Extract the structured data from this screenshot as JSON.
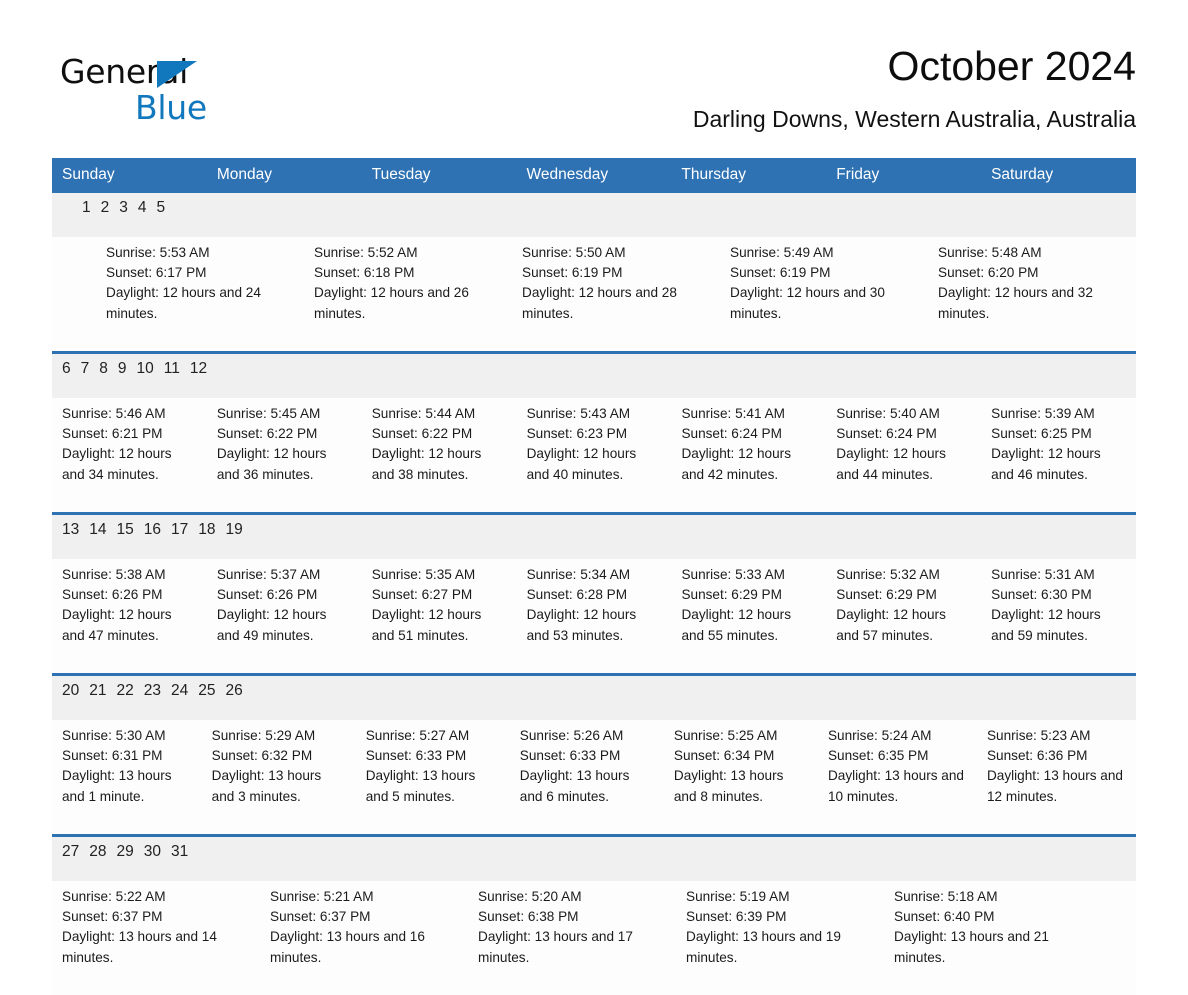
{
  "brand": {
    "name_part1": "General",
    "name_part2": "Blue",
    "triangle_icon": "blue-triangle-logo-mark",
    "accent_color": "#1278be"
  },
  "header": {
    "title": "October 2024",
    "location": "Darling Downs, Western Australia, Australia"
  },
  "colors": {
    "header_blue": "#2e72b3",
    "daynum_band": "#f0f0f0",
    "text": "#1a1a1a"
  },
  "weekday_headers": [
    "Sunday",
    "Monday",
    "Tuesday",
    "Wednesday",
    "Thursday",
    "Friday",
    "Saturday"
  ],
  "weeks": [
    {
      "days": [
        {
          "num": "",
          "sunrise": "",
          "sunset": "",
          "daylight": ""
        },
        {
          "num": "",
          "sunrise": "",
          "sunset": "",
          "daylight": ""
        },
        {
          "num": "1",
          "sunrise": "Sunrise: 5:53 AM",
          "sunset": "Sunset: 6:17 PM",
          "daylight": "Daylight: 12 hours and 24 minutes."
        },
        {
          "num": "2",
          "sunrise": "Sunrise: 5:52 AM",
          "sunset": "Sunset: 6:18 PM",
          "daylight": "Daylight: 12 hours and 26 minutes."
        },
        {
          "num": "3",
          "sunrise": "Sunrise: 5:50 AM",
          "sunset": "Sunset: 6:19 PM",
          "daylight": "Daylight: 12 hours and 28 minutes."
        },
        {
          "num": "4",
          "sunrise": "Sunrise: 5:49 AM",
          "sunset": "Sunset: 6:19 PM",
          "daylight": "Daylight: 12 hours and 30 minutes."
        },
        {
          "num": "5",
          "sunrise": "Sunrise: 5:48 AM",
          "sunset": "Sunset: 6:20 PM",
          "daylight": "Daylight: 12 hours and 32 minutes."
        }
      ]
    },
    {
      "days": [
        {
          "num": "6",
          "sunrise": "Sunrise: 5:46 AM",
          "sunset": "Sunset: 6:21 PM",
          "daylight": "Daylight: 12 hours and 34 minutes."
        },
        {
          "num": "7",
          "sunrise": "Sunrise: 5:45 AM",
          "sunset": "Sunset: 6:22 PM",
          "daylight": "Daylight: 12 hours and 36 minutes."
        },
        {
          "num": "8",
          "sunrise": "Sunrise: 5:44 AM",
          "sunset": "Sunset: 6:22 PM",
          "daylight": "Daylight: 12 hours and 38 minutes."
        },
        {
          "num": "9",
          "sunrise": "Sunrise: 5:43 AM",
          "sunset": "Sunset: 6:23 PM",
          "daylight": "Daylight: 12 hours and 40 minutes."
        },
        {
          "num": "10",
          "sunrise": "Sunrise: 5:41 AM",
          "sunset": "Sunset: 6:24 PM",
          "daylight": "Daylight: 12 hours and 42 minutes."
        },
        {
          "num": "11",
          "sunrise": "Sunrise: 5:40 AM",
          "sunset": "Sunset: 6:24 PM",
          "daylight": "Daylight: 12 hours and 44 minutes."
        },
        {
          "num": "12",
          "sunrise": "Sunrise: 5:39 AM",
          "sunset": "Sunset: 6:25 PM",
          "daylight": "Daylight: 12 hours and 46 minutes."
        }
      ]
    },
    {
      "days": [
        {
          "num": "13",
          "sunrise": "Sunrise: 5:38 AM",
          "sunset": "Sunset: 6:26 PM",
          "daylight": "Daylight: 12 hours and 47 minutes."
        },
        {
          "num": "14",
          "sunrise": "Sunrise: 5:37 AM",
          "sunset": "Sunset: 6:26 PM",
          "daylight": "Daylight: 12 hours and 49 minutes."
        },
        {
          "num": "15",
          "sunrise": "Sunrise: 5:35 AM",
          "sunset": "Sunset: 6:27 PM",
          "daylight": "Daylight: 12 hours and 51 minutes."
        },
        {
          "num": "16",
          "sunrise": "Sunrise: 5:34 AM",
          "sunset": "Sunset: 6:28 PM",
          "daylight": "Daylight: 12 hours and 53 minutes."
        },
        {
          "num": "17",
          "sunrise": "Sunrise: 5:33 AM",
          "sunset": "Sunset: 6:29 PM",
          "daylight": "Daylight: 12 hours and 55 minutes."
        },
        {
          "num": "18",
          "sunrise": "Sunrise: 5:32 AM",
          "sunset": "Sunset: 6:29 PM",
          "daylight": "Daylight: 12 hours and 57 minutes."
        },
        {
          "num": "19",
          "sunrise": "Sunrise: 5:31 AM",
          "sunset": "Sunset: 6:30 PM",
          "daylight": "Daylight: 12 hours and 59 minutes."
        }
      ]
    },
    {
      "days": [
        {
          "num": "20",
          "sunrise": "Sunrise: 5:30 AM",
          "sunset": "Sunset: 6:31 PM",
          "daylight": "Daylight: 13 hours and 1 minute."
        },
        {
          "num": "21",
          "sunrise": "Sunrise: 5:29 AM",
          "sunset": "Sunset: 6:32 PM",
          "daylight": "Daylight: 13 hours and 3 minutes."
        },
        {
          "num": "22",
          "sunrise": "Sunrise: 5:27 AM",
          "sunset": "Sunset: 6:33 PM",
          "daylight": "Daylight: 13 hours and 5 minutes."
        },
        {
          "num": "23",
          "sunrise": "Sunrise: 5:26 AM",
          "sunset": "Sunset: 6:33 PM",
          "daylight": "Daylight: 13 hours and 6 minutes."
        },
        {
          "num": "24",
          "sunrise": "Sunrise: 5:25 AM",
          "sunset": "Sunset: 6:34 PM",
          "daylight": "Daylight: 13 hours and 8 minutes."
        },
        {
          "num": "25",
          "sunrise": "Sunrise: 5:24 AM",
          "sunset": "Sunset: 6:35 PM",
          "daylight": "Daylight: 13 hours and 10 minutes."
        },
        {
          "num": "26",
          "sunrise": "Sunrise: 5:23 AM",
          "sunset": "Sunset: 6:36 PM",
          "daylight": "Daylight: 13 hours and 12 minutes."
        }
      ]
    },
    {
      "days": [
        {
          "num": "27",
          "sunrise": "Sunrise: 5:22 AM",
          "sunset": "Sunset: 6:37 PM",
          "daylight": "Daylight: 13 hours and 14 minutes."
        },
        {
          "num": "28",
          "sunrise": "Sunrise: 5:21 AM",
          "sunset": "Sunset: 6:37 PM",
          "daylight": "Daylight: 13 hours and 16 minutes."
        },
        {
          "num": "29",
          "sunrise": "Sunrise: 5:20 AM",
          "sunset": "Sunset: 6:38 PM",
          "daylight": "Daylight: 13 hours and 17 minutes."
        },
        {
          "num": "30",
          "sunrise": "Sunrise: 5:19 AM",
          "sunset": "Sunset: 6:39 PM",
          "daylight": "Daylight: 13 hours and 19 minutes."
        },
        {
          "num": "31",
          "sunrise": "Sunrise: 5:18 AM",
          "sunset": "Sunset: 6:40 PM",
          "daylight": "Daylight: 13 hours and 21 minutes."
        },
        {
          "num": "",
          "sunrise": "",
          "sunset": "",
          "daylight": ""
        },
        {
          "num": "",
          "sunrise": "",
          "sunset": "",
          "daylight": ""
        }
      ]
    }
  ]
}
